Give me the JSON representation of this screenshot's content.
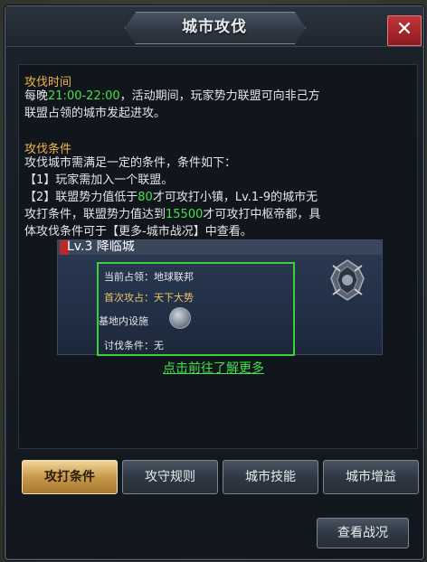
{
  "dialog": {
    "title": "城市攻伐",
    "close_label": "✕"
  },
  "time_section": {
    "heading": "攻伐时间",
    "line1_pre": "每晚",
    "time_range": "21:00-22:00",
    "line1_post": "，活动期间，玩家势力联盟可向非己方",
    "line2": "联盟占领的城市发起进攻。"
  },
  "condition_section": {
    "heading": "攻伐条件",
    "intro": "攻伐城市需满足一定的条件，条件如下：",
    "item1": "【1】玩家需加入一个联盟。",
    "item2_pre": "【2】联盟势力值低于",
    "threshold_small": "80",
    "item2_mid": "才可攻打小镇，Lv.1-9的城市无",
    "item2_line2_pre": "攻打条件，联盟势力值达到",
    "threshold_large": "15500",
    "item2_line2_post": "才可攻打中枢帝都，具",
    "item2_line3": "体攻伐条件可于【更多-城市战况】中查看。"
  },
  "preview": {
    "level_text": "Lv.3  降临城",
    "occupier_label": "当前占领：地球联邦",
    "first_attack_label": "首次攻占：天下大势",
    "facility_label": "基地内设施",
    "condition_label": "讨伐条件：无"
  },
  "more_link": "点击前往了解更多",
  "tabs": [
    {
      "label": "攻打条件",
      "active": true
    },
    {
      "label": "攻守规则",
      "active": false
    },
    {
      "label": "城市技能",
      "active": false
    },
    {
      "label": "城市增益",
      "active": false
    }
  ],
  "view_battle_button": "查看战况",
  "colors": {
    "accent_gold": "#f0b44a",
    "highlight_green": "#45e04a",
    "close_red": "#c2343b"
  }
}
